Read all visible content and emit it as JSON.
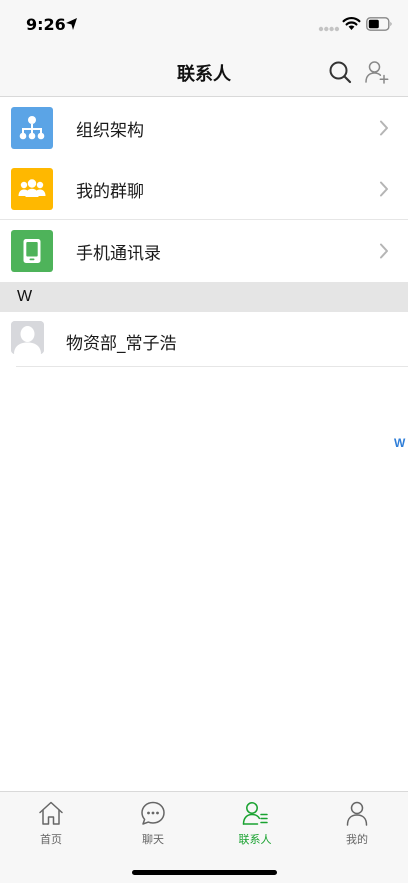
{
  "status_bar": {
    "time": "9:26",
    "icons": [
      "location-arrow-icon",
      "signal-dots-icon",
      "wifi-icon",
      "battery-icon"
    ]
  },
  "nav": {
    "title": "联系人",
    "right_icons": [
      "search-icon",
      "add-contact-icon"
    ]
  },
  "menu": [
    {
      "label": "组织架构",
      "icon": "org-chart-icon",
      "color": "#5ba4e6"
    },
    {
      "label": "我的群聊",
      "icon": "group-chat-icon",
      "color": "#ffb800"
    },
    {
      "label": "手机通讯录",
      "icon": "phone-contacts-icon",
      "color": "#4eb35a"
    }
  ],
  "section": {
    "letter": "W"
  },
  "contacts": [
    {
      "name": "物资部_常子浩",
      "avatar": "default-avatar-icon"
    }
  ],
  "index": {
    "letters": [
      "W"
    ]
  },
  "tabs": [
    {
      "label": "首页",
      "icon": "home-icon",
      "active": false
    },
    {
      "label": "聊天",
      "icon": "chat-bubble-icon",
      "active": false
    },
    {
      "label": "联系人",
      "icon": "contacts-icon",
      "active": true
    },
    {
      "label": "我的",
      "icon": "profile-icon",
      "active": false
    }
  ],
  "colors": {
    "accent": "#19a230",
    "index": "#2f7ed8",
    "section_bg": "#e5e5e5",
    "bar_bg": "#f7f7f7"
  }
}
